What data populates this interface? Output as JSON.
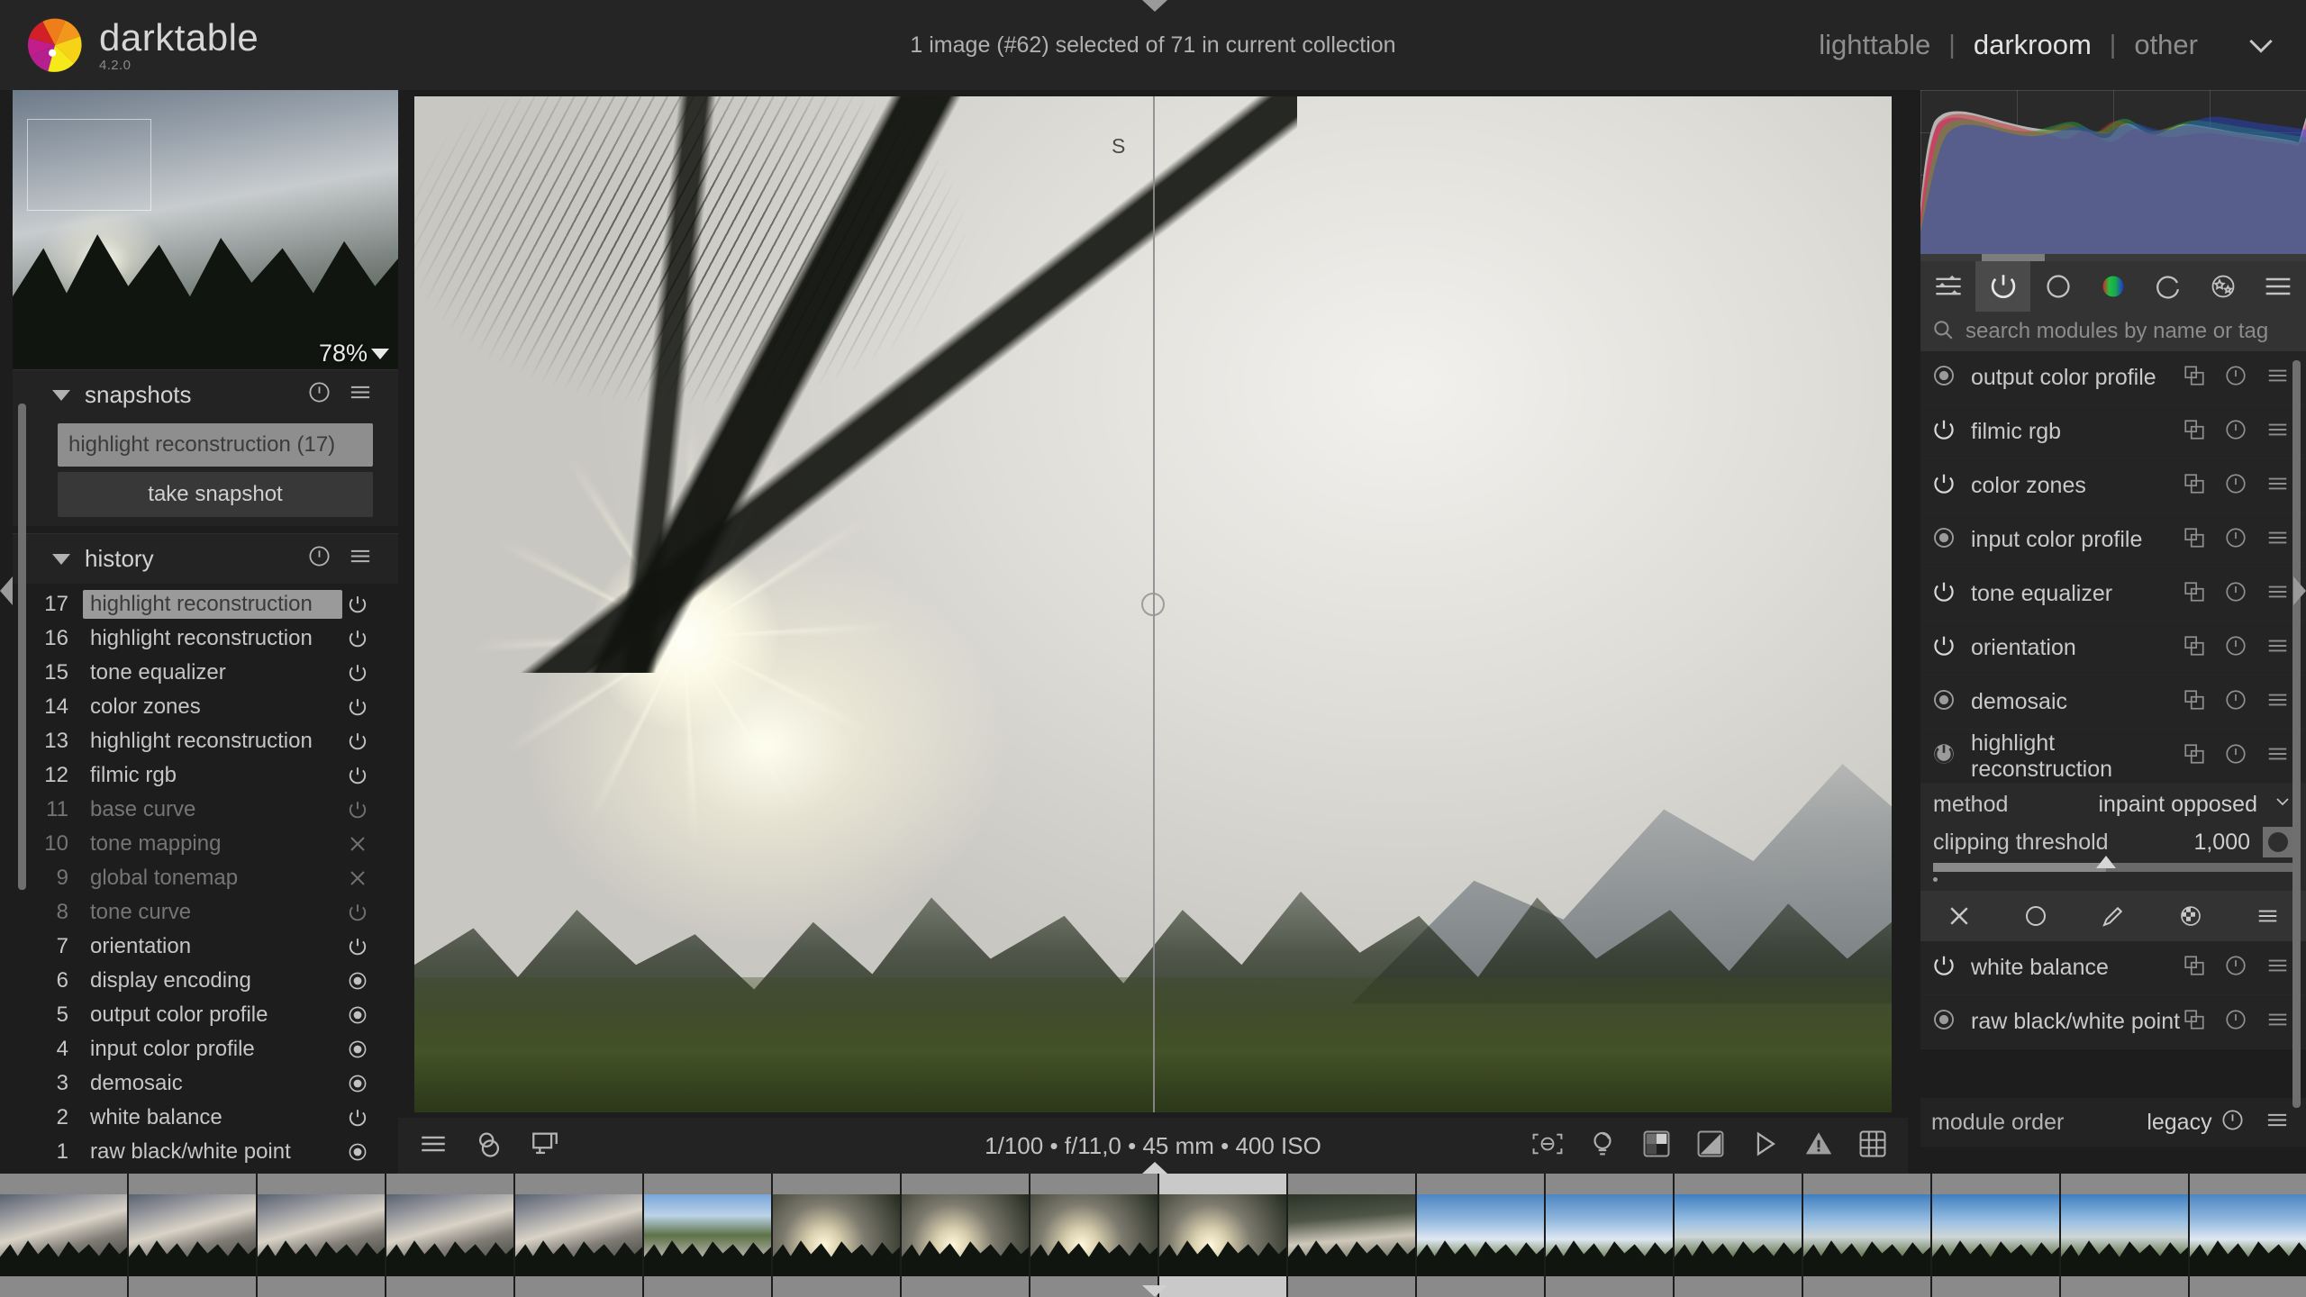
{
  "app": {
    "name": "darktable",
    "version": "4.2.0"
  },
  "header": {
    "status": "1 image (#62) selected of 71 in current collection",
    "views": [
      {
        "label": "lighttable",
        "active": false
      },
      {
        "label": "darkroom",
        "active": true
      },
      {
        "label": "other",
        "active": false
      }
    ],
    "separator": "|",
    "chevron_icon": "chevron-down-icon"
  },
  "navigation": {
    "zoom_level": "78%",
    "zoom_dropdown_icon": "triangle-down-icon"
  },
  "snapshots": {
    "title": "snapshots",
    "expanded": true,
    "reset_icon": "reset-icon",
    "presets_icon": "hamburger-icon",
    "items": [
      {
        "label": "highlight reconstruction (17)",
        "active": true
      }
    ],
    "take_snapshot_label": "take snapshot",
    "overlay_letter": "S"
  },
  "history": {
    "title": "history",
    "expanded": true,
    "reset_icon": "reset-icon",
    "presets_icon": "hamburger-icon",
    "items": [
      {
        "num": "17",
        "label": "highlight reconstruction",
        "action": "power",
        "selected": true,
        "dim": false
      },
      {
        "num": "16",
        "label": "highlight reconstruction",
        "action": "power",
        "selected": false,
        "dim": false
      },
      {
        "num": "15",
        "label": "tone equalizer",
        "action": "power",
        "selected": false,
        "dim": false
      },
      {
        "num": "14",
        "label": "color zones",
        "action": "power",
        "selected": false,
        "dim": false
      },
      {
        "num": "13",
        "label": "highlight reconstruction",
        "action": "power",
        "selected": false,
        "dim": false
      },
      {
        "num": "12",
        "label": "filmic rgb",
        "action": "power",
        "selected": false,
        "dim": false
      },
      {
        "num": "11",
        "label": "base curve",
        "action": "power",
        "selected": false,
        "dim": true
      },
      {
        "num": "10",
        "label": "tone mapping",
        "action": "cross",
        "selected": false,
        "dim": true
      },
      {
        "num": "9",
        "label": "global tonemap",
        "action": "cross",
        "selected": false,
        "dim": true
      },
      {
        "num": "8",
        "label": "tone curve",
        "action": "power",
        "selected": false,
        "dim": true
      },
      {
        "num": "7",
        "label": "orientation",
        "action": "power",
        "selected": false,
        "dim": false
      },
      {
        "num": "6",
        "label": "display encoding",
        "action": "always",
        "selected": false,
        "dim": false
      },
      {
        "num": "5",
        "label": "output color profile",
        "action": "always",
        "selected": false,
        "dim": false
      },
      {
        "num": "4",
        "label": "input color profile",
        "action": "always",
        "selected": false,
        "dim": false
      },
      {
        "num": "3",
        "label": "demosaic",
        "action": "always",
        "selected": false,
        "dim": false
      },
      {
        "num": "2",
        "label": "white balance",
        "action": "power",
        "selected": false,
        "dim": false
      },
      {
        "num": "1",
        "label": "raw black/white point",
        "action": "always",
        "selected": false,
        "dim": false
      }
    ]
  },
  "center_toolbar": {
    "left_icons": [
      "hamburger-icon",
      "color-assessment-icon",
      "second-window-icon"
    ],
    "exif": "1/100 • f/11,0 • 45 mm • 400 ISO",
    "right_icons": [
      "focus-peaking-icon",
      "lighting-icon",
      "iso12646-icon",
      "gamut-check-icon",
      "softproof-icon",
      "overexposed-icon",
      "guides-icon"
    ]
  },
  "module_groups": {
    "tabs": [
      {
        "icon": "active-modules-icon",
        "active": false
      },
      {
        "icon": "technical-group-icon",
        "active": true
      },
      {
        "icon": "tone-group-icon",
        "active": false
      },
      {
        "icon": "color-group-icon",
        "active": false
      },
      {
        "icon": "correct-group-icon",
        "active": false
      },
      {
        "icon": "effects-group-icon",
        "active": false
      },
      {
        "icon": "presets-hamburger-icon",
        "active": false
      }
    ]
  },
  "module_search": {
    "placeholder": "search modules by name or tag",
    "value": "",
    "icon": "search-icon"
  },
  "modules": [
    {
      "name": "output color profile",
      "state": "always",
      "expanded": false
    },
    {
      "name": "filmic rgb",
      "state": "on",
      "expanded": false
    },
    {
      "name": "color zones",
      "state": "on",
      "expanded": false
    },
    {
      "name": "input color profile",
      "state": "always",
      "expanded": false
    },
    {
      "name": "tone equalizer",
      "state": "on",
      "expanded": false
    },
    {
      "name": "orientation",
      "state": "on",
      "expanded": false
    },
    {
      "name": "demosaic",
      "state": "always",
      "expanded": false
    },
    {
      "name": "highlight reconstruction",
      "state": "on-hl",
      "expanded": true
    },
    {
      "name": "white balance",
      "state": "on",
      "expanded": false
    },
    {
      "name": "raw black/white point",
      "state": "always",
      "expanded": false
    }
  ],
  "module_row_icons": [
    "multi-instance-icon",
    "reset-icon",
    "presets-hamburger-icon"
  ],
  "highlight_reconstruction_params": {
    "method_label": "method",
    "method_value": "inpaint opposed",
    "method_chevron_icon": "chevron-down-icon",
    "clipping_label": "clipping threshold",
    "clipping_value": "1,000",
    "clipping_slider_percent": 48,
    "color_picker_icon": "color-picker-icon"
  },
  "blend_bar": {
    "icons": [
      "blend-off-icon",
      "blend-uniformly-icon",
      "blend-drawn-mask-icon",
      "blend-parametric-mask-icon",
      "blend-presets-icon"
    ]
  },
  "module_order": {
    "label": "module order",
    "value": "legacy",
    "reset_icon": "reset-icon",
    "presets_icon": "hamburger-icon"
  },
  "filmstrip": {
    "selected_index": 9,
    "cells": [
      {
        "scene": "t-sunsetclouds"
      },
      {
        "scene": "t-sunsetclouds"
      },
      {
        "scene": "t-sunsetclouds"
      },
      {
        "scene": "t-sunsetclouds"
      },
      {
        "scene": "t-sunsetclouds"
      },
      {
        "scene": "t-river"
      },
      {
        "scene": "t-sunray"
      },
      {
        "scene": "t-sunray"
      },
      {
        "scene": "t-sunray"
      },
      {
        "scene": "t-sunray"
      },
      {
        "scene": "t-trees"
      },
      {
        "scene": "t-brightsky"
      },
      {
        "scene": "t-brightsky"
      },
      {
        "scene": "t-mountain"
      },
      {
        "scene": "t-mountain"
      },
      {
        "scene": "t-mountain"
      },
      {
        "scene": "t-mountain"
      },
      {
        "scene": "t-brightsky"
      }
    ]
  },
  "colors": {
    "background": "#1d1d1d",
    "panel": "#232323",
    "row": "#242424",
    "accent_selected": "#9a9a9a",
    "text": "#c6c6c6",
    "text_dim": "#757575"
  },
  "histogram": {
    "mode": "rgb-overlaid",
    "grid": true
  }
}
